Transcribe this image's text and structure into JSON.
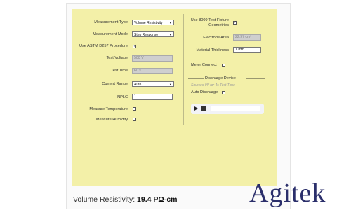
{
  "form": {
    "measurement_type": {
      "label": "Measurement Type",
      "value": "Volume Resistivity"
    },
    "measurement_mode": {
      "label": "Measurement Mode",
      "value": "Step Response"
    },
    "astm": {
      "label": "Use ASTM D257 Procedure",
      "checked": true
    },
    "test_voltage": {
      "label": "Test Voltage",
      "value": "500 V"
    },
    "test_time": {
      "label": "Test Time",
      "value": "60 s"
    },
    "current_range": {
      "label": "Current Range",
      "value": "Auto"
    },
    "nplc": {
      "label": "NPLC",
      "value": "1"
    },
    "measure_temperature": {
      "label": "Measure Temperature",
      "checked": false
    },
    "measure_humidity": {
      "label": "Measure Humidity",
      "checked": false
    },
    "fixture": {
      "label_line1": "Use 8009 Test Fixture",
      "label_line2": "Geometries",
      "checked": true
    },
    "electrode_area": {
      "label": "Electrode Area",
      "value": "22.97 cm²"
    },
    "material_thickness": {
      "label": "Material Thickness",
      "value": "1 mm"
    },
    "meter_connect": {
      "label": "Meter Connect",
      "checked": false
    },
    "discharge": {
      "title": "Discharge Device",
      "note": "Sources 0V for 4s Test Time",
      "auto_label": "Auto Discharge",
      "checked": false
    }
  },
  "result": {
    "label": "Volume Resistivity:",
    "value": "19.4 PΩ-cm"
  },
  "brand": "Agitek",
  "colors": {
    "panel": "#f3f0a8",
    "brand": "#2b2f6b"
  }
}
